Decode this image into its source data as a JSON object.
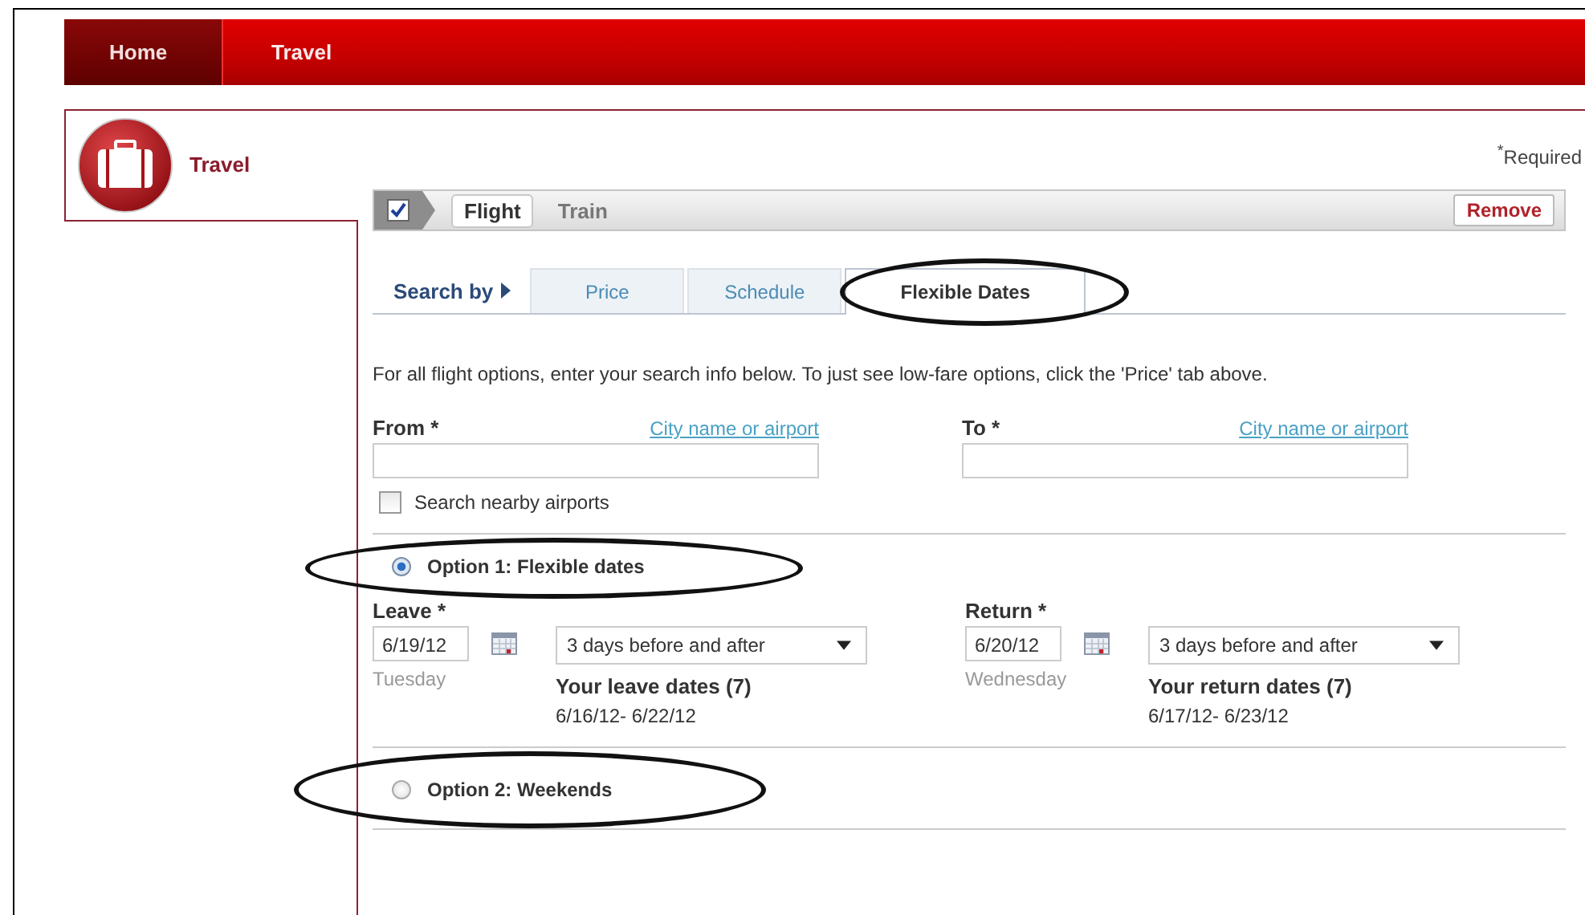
{
  "nav": [
    {
      "label": "Home",
      "selected": true
    },
    {
      "label": "Travel",
      "selected": false
    }
  ],
  "sidebar": {
    "title": "Travel"
  },
  "required": "$^{*}$Required",
  "mode_bar": {
    "checked": true,
    "modes": [
      {
        "label": "Flight",
        "selected": true
      },
      {
        "label": "Train",
        "selected": false
      }
    ],
    "remove": "Remove"
  },
  "search_by": {
    "label": "Search by",
    "tabs": [
      {
        "label": "Price",
        "selected": false,
        "circled": false
      },
      {
        "label": "Schedule",
        "selected": false,
        "circled": false
      },
      {
        "label": "Flexible Dates",
        "selected": true,
        "circled": true
      }
    ]
  },
  "intro": "For all flight options, enter your search info below. To just see low-fare options, click the 'Price' tab above.",
  "places": [
    {
      "label": "From *",
      "hint": "City name or airport"
    },
    {
      "label": "To *",
      "hint": "City name or airport"
    }
  ],
  "nearby": {
    "label": "Search nearby airports",
    "checked": false
  },
  "options": [
    {
      "kind": "flexible",
      "label": "Option 1: Flexible dates",
      "selected": true,
      "circled": true,
      "dates": [
        {
          "label": "Leave *",
          "date": "6/19/12",
          "weekday": "Tuesday",
          "range": "3 days before and after",
          "summary": "Your leave dates (7)",
          "span": "6/16/12- 6/22/12"
        },
        {
          "label": "Return *",
          "date": "6/20/12",
          "weekday": "Wednesday",
          "range": "3 days before and after",
          "summary": "Your return dates (7)",
          "span": "6/17/12- 6/23/12"
        }
      ]
    },
    {
      "kind": "weekends",
      "label": "Option 2: Weekends",
      "selected": false,
      "circled": true
    }
  ]
}
